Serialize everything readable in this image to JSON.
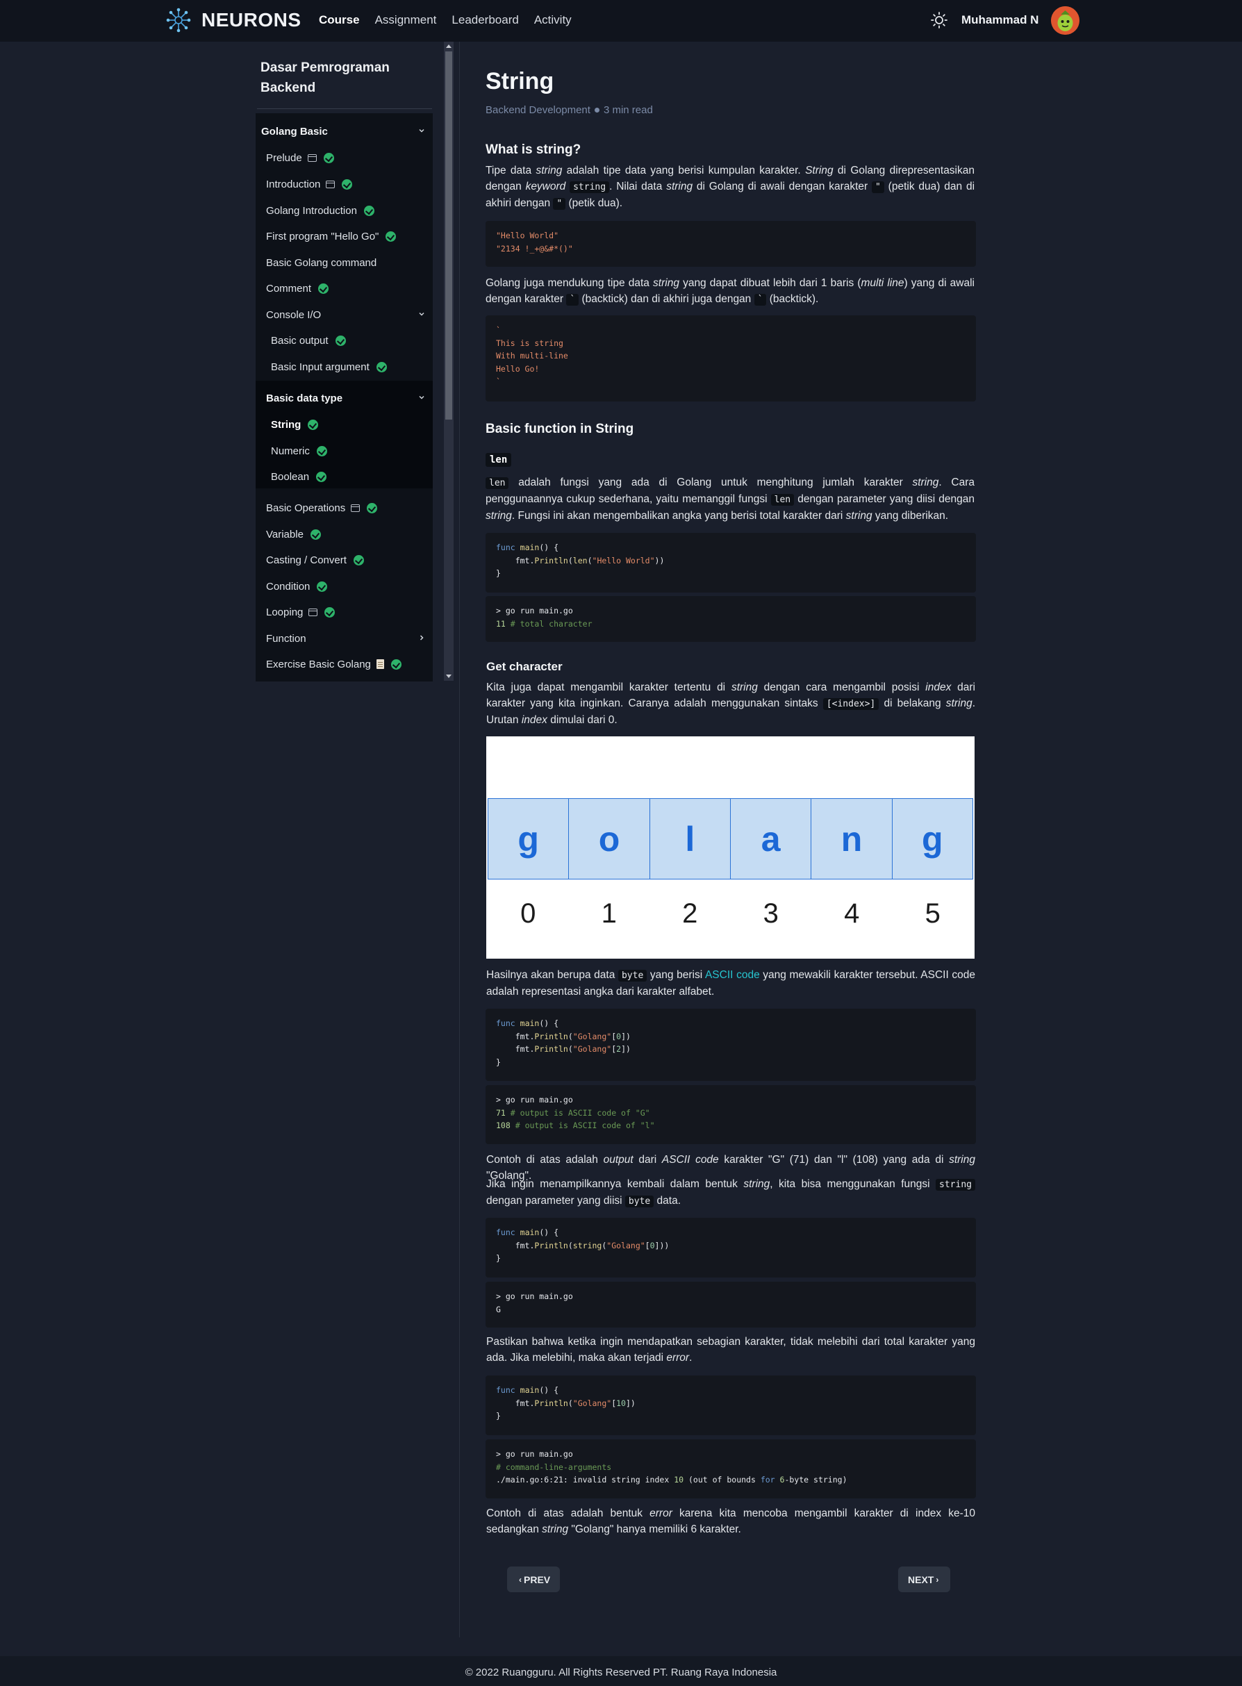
{
  "navbar": {
    "brand": "NEURONS",
    "links": [
      "Course",
      "Assignment",
      "Leaderboard",
      "Activity"
    ],
    "user_name": "Muhammad N"
  },
  "sidebar": {
    "course_title": "Dasar Pemrograman Backend",
    "sections": {
      "golang_basic": "Golang Basic",
      "console_io": "Console I/O",
      "basic_data_type": "Basic data type",
      "function": "Function"
    },
    "items": {
      "prelude": "Prelude",
      "introduction": "Introduction",
      "golang_introduction": "Golang Introduction",
      "first_program": "First program \"Hello Go\"",
      "basic_golang_command": "Basic Golang command",
      "comment": "Comment",
      "basic_output": "Basic output",
      "basic_input_argument": "Basic Input argument",
      "string": "String",
      "numeric": "Numeric",
      "boolean": "Boolean",
      "basic_operations": "Basic Operations",
      "variable": "Variable",
      "casting_convert": "Casting / Convert",
      "condition": "Condition",
      "looping": "Looping",
      "exercise_basic_golang": "Exercise Basic Golang"
    }
  },
  "article": {
    "title": "String",
    "category": "Backend Development",
    "read_time": "3 min read",
    "h_what_is_string": "What is string?",
    "h_basic_function": "Basic function in String",
    "h_len": "len",
    "h_get_character": "Get character",
    "next_label": "NEXT",
    "prev_label": "PREV",
    "golang_letters": [
      "g",
      "o",
      "l",
      "a",
      "n",
      "g"
    ],
    "golang_indexes": [
      "0",
      "1",
      "2",
      "3",
      "4",
      "5"
    ]
  },
  "footer": {
    "text": "© 2022 Ruangguru. All Rights Reserved PT. Ruang Raya Indonesia"
  },
  "colors": {
    "background": "#1a1f2c",
    "navbar": "#10141d",
    "sidebar_list": "#0d1118",
    "check_green": "#2eb36a",
    "link_teal": "#27c4cf",
    "figure_blue": "#1c68d6"
  }
}
